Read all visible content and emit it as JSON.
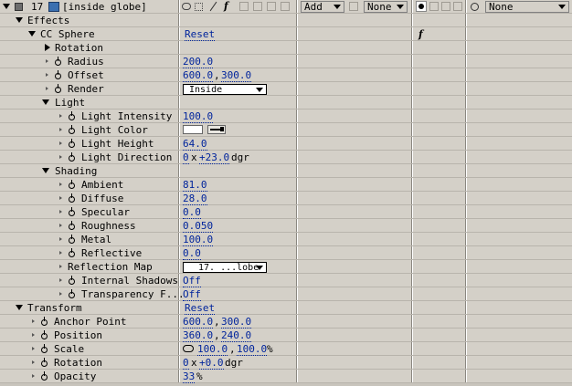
{
  "layer": {
    "number": "17",
    "name": "[inside globe]",
    "mode": "Add",
    "trkmat": "None",
    "parent": "None"
  },
  "effects": {
    "label": "Effects",
    "cc_sphere": {
      "label": "CC Sphere",
      "reset": "Reset",
      "rotation": "Rotation",
      "radius": {
        "label": "Radius",
        "value": "200.0"
      },
      "offset": {
        "label": "Offset",
        "x": "600.0",
        "y": "300.0"
      },
      "render": {
        "label": "Render",
        "value": "Inside"
      },
      "light": {
        "label": "Light",
        "intensity": {
          "label": "Light Intensity",
          "value": "100.0"
        },
        "color": {
          "label": "Light Color",
          "value": "#ffffff"
        },
        "height": {
          "label": "Light Height",
          "value": "64.0"
        },
        "direction": {
          "label": "Light Direction",
          "revs": "0",
          "deg": "+23.0",
          "unit": "dgr"
        }
      },
      "shading": {
        "label": "Shading",
        "ambient": {
          "label": "Ambient",
          "value": "81.0"
        },
        "diffuse": {
          "label": "Diffuse",
          "value": "28.0"
        },
        "specular": {
          "label": "Specular",
          "value": "0.0"
        },
        "roughness": {
          "label": "Roughness",
          "value": "0.050"
        },
        "metal": {
          "label": "Metal",
          "value": "100.0"
        },
        "reflective": {
          "label": "Reflective",
          "value": "0.0"
        },
        "reflection_map": {
          "label": "Reflection Map",
          "value": "17. ...lobe"
        },
        "internal_shadows": {
          "label": "Internal Shadows",
          "value": "Off"
        },
        "transparency": {
          "label": "Transparency F...",
          "value": "Off"
        }
      }
    }
  },
  "transform": {
    "label": "Transform",
    "reset": "Reset",
    "anchor": {
      "label": "Anchor Point",
      "x": "600.0",
      "y": "300.0"
    },
    "position": {
      "label": "Position",
      "x": "360.0",
      "y": "240.0"
    },
    "scale": {
      "label": "Scale",
      "x": "100.0",
      "y": "100.0",
      "unit": "%"
    },
    "rotation": {
      "label": "Rotation",
      "revs": "0",
      "deg": "+0.0",
      "unit": "dgr"
    },
    "opacity": {
      "label": "Opacity",
      "value": "33",
      "unit": "%"
    }
  },
  "ui": {
    "x_sep": "x",
    "comma": ",",
    "fx_glyph": "f"
  }
}
